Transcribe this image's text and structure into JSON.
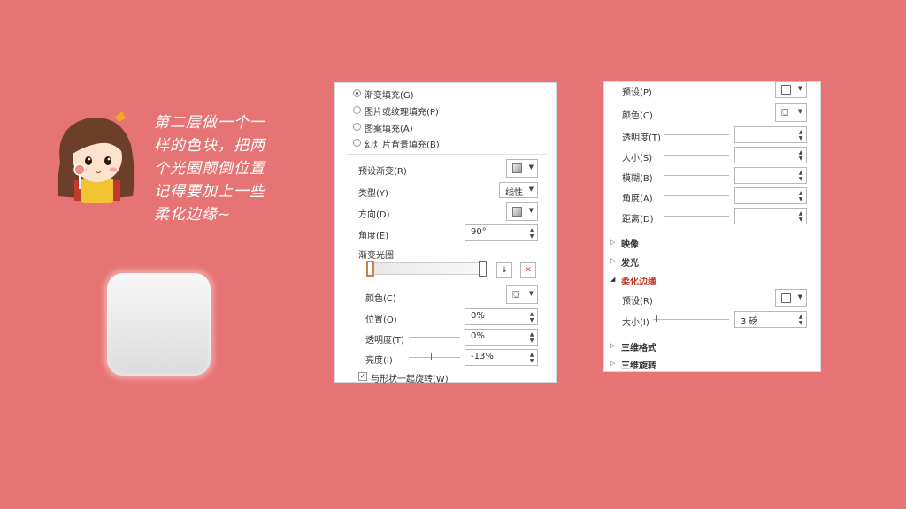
{
  "caption": {
    "line1": "第二层做一个一",
    "line2": "样的色块，把两",
    "line3": "个光圈颠倒位置",
    "line4": "记得要加上一些",
    "line5": "柔化边缘~"
  },
  "panel_a": {
    "fill_options": [
      {
        "label": "渐变填充(G)",
        "selected": true
      },
      {
        "label": "图片或纹理填充(P)",
        "selected": false
      },
      {
        "label": "图案填充(A)",
        "selected": false
      },
      {
        "label": "幻灯片背景填充(B)",
        "selected": false
      }
    ],
    "preset_label": "预设渐变(R)",
    "type_label": "类型(Y)",
    "type_value": "线性",
    "direction_label": "方向(D)",
    "angle_label": "角度(E)",
    "angle_value": "90°",
    "stops_label": "渐变光圈",
    "color_label": "颜色(C)",
    "position_label": "位置(O)",
    "position_value": "0%",
    "transparency_label": "透明度(T)",
    "transparency_value": "0%",
    "brightness_label": "亮度(I)",
    "brightness_value": "-13%",
    "rotate_label": "与形状一起旋转(W)",
    "rotate_checked": true
  },
  "panel_b": {
    "preset_label": "预设(P)",
    "color_label": "颜色(C)",
    "transparency_label": "透明度(T)",
    "size_label": "大小(S)",
    "blur_label": "模糊(B)",
    "angle_label": "角度(A)",
    "distance_label": "距离(D)",
    "reflection_label": "映像",
    "glow_label": "发光",
    "soft_edges_label": "柔化边缘",
    "soft_preset_label": "预设(R)",
    "soft_size_label": "大小(I)",
    "soft_size_value": "3 磅",
    "3d_format_label": "三维格式",
    "3d_rotation_label": "三维旋转"
  }
}
